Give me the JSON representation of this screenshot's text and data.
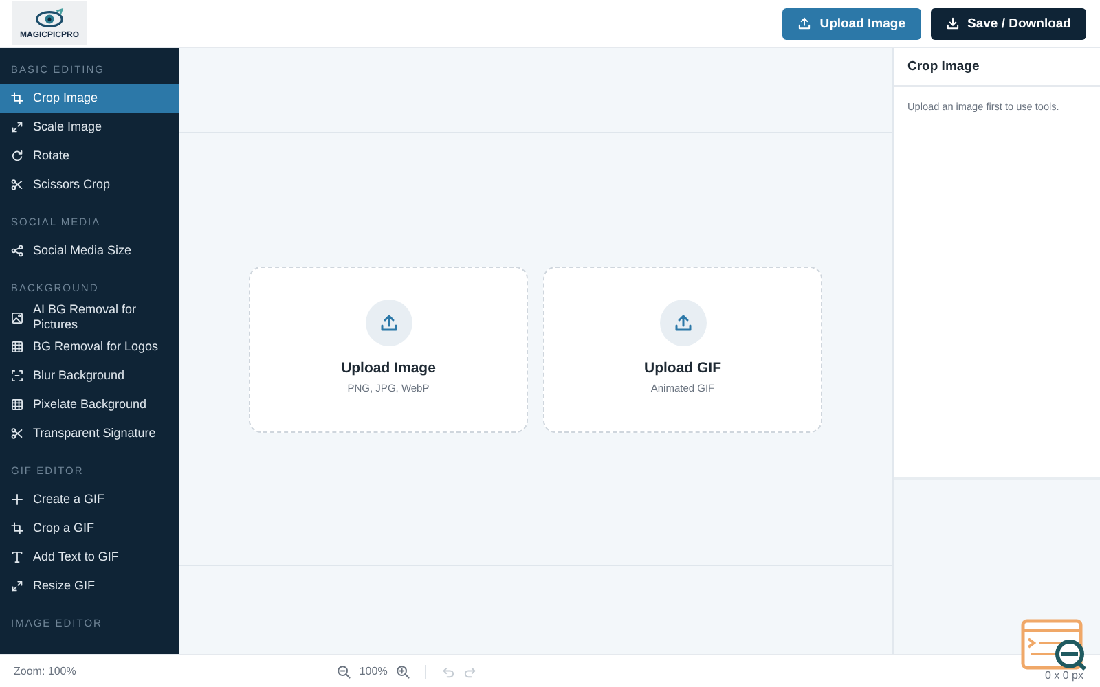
{
  "logo": {
    "text": "MAGICPICPRO"
  },
  "header_buttons": [
    {
      "label": "Upload Image",
      "kind": "upload"
    },
    {
      "label": "Save / Download",
      "kind": "save"
    }
  ],
  "sidebar": {
    "sections": [
      {
        "title": "BASIC EDITING",
        "items": [
          {
            "label": "Crop Image",
            "kind": "crop",
            "selected": true
          },
          {
            "label": "Scale Image",
            "kind": "expand",
            "selected": false
          },
          {
            "label": "Rotate",
            "kind": "rotate",
            "selected": false
          },
          {
            "label": "Scissors Crop",
            "kind": "scissors",
            "selected": false
          }
        ]
      },
      {
        "title": "SOCIAL MEDIA",
        "items": [
          {
            "label": "Social Media Size",
            "kind": "share",
            "selected": false
          }
        ]
      },
      {
        "title": "BACKGROUND",
        "items": [
          {
            "label": "AI BG Removal for Pictures",
            "kind": "image",
            "selected": false
          },
          {
            "label": "BG Removal for Logos",
            "kind": "grid",
            "selected": false
          },
          {
            "label": "Blur Background",
            "kind": "focus",
            "selected": false
          },
          {
            "label": "Pixelate Background",
            "kind": "grid",
            "selected": false
          },
          {
            "label": "Transparent Signature",
            "kind": "scissors",
            "selected": false
          }
        ]
      },
      {
        "title": "GIF EDITOR",
        "items": [
          {
            "label": "Create a GIF",
            "kind": "plus",
            "selected": false
          },
          {
            "label": "Crop a GIF",
            "kind": "crop",
            "selected": false
          },
          {
            "label": "Add Text to GIF",
            "kind": "text",
            "selected": false
          },
          {
            "label": "Resize GIF",
            "kind": "expand",
            "selected": false
          }
        ]
      },
      {
        "title": "IMAGE EDITOR"
      }
    ]
  },
  "upload_cards": [
    {
      "title": "Upload Image",
      "subtitle": "PNG, JPG, WebP"
    },
    {
      "title": "Upload GIF",
      "subtitle": "Animated GIF"
    }
  ],
  "panel": {
    "title": "Crop Image",
    "message": "Upload an image first to use tools."
  },
  "status_bar": {
    "zoom_label": "Zoom: 100%",
    "zoom_value": "100%",
    "dimensions": "0 x 0 px"
  }
}
